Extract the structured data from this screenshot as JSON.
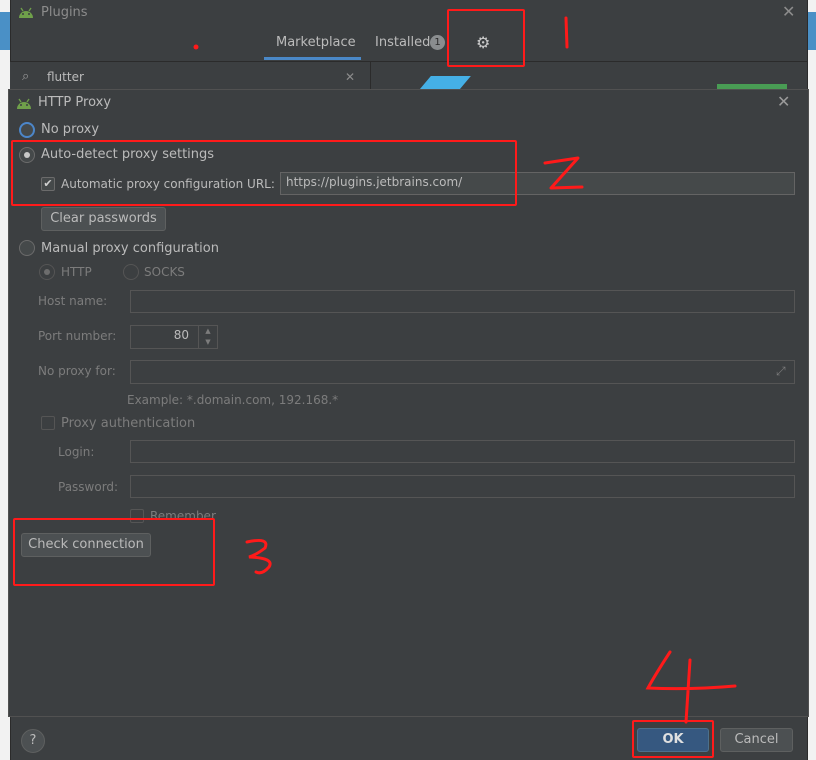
{
  "plugins_window": {
    "title": "Plugins",
    "tabs": [
      {
        "label": "Marketplace"
      },
      {
        "label": "Installed",
        "badge": "1"
      }
    ],
    "search_value": "flutter"
  },
  "proxy_dialog": {
    "title": "HTTP Proxy",
    "no_proxy": {
      "label": "No proxy"
    },
    "auto_detect": {
      "label": "Auto-detect proxy settings",
      "selected": true
    },
    "auto_config_url": {
      "label": "Automatic proxy configuration URL:",
      "checked": true,
      "value": "https://plugins.jetbrains.com/"
    },
    "clear_passwords_label": "Clear passwords",
    "manual": {
      "label": "Manual proxy configuration"
    },
    "http_label": "HTTP",
    "socks_label": "SOCKS",
    "host_name_label": "Host name:",
    "port_number_label": "Port number:",
    "port_value": "80",
    "no_proxy_for_label": "No proxy for:",
    "example_text": "Example: *.domain.com, 192.168.*",
    "proxy_auth_label": "Proxy authentication",
    "login_label": "Login:",
    "password_label": "Password:",
    "remember_label": "Remember",
    "check_connection_label": "Check connection",
    "help_label": "?",
    "ok_label": "OK",
    "cancel_label": "Cancel"
  },
  "annotation_color": "#ff1a1a",
  "accent_color": "#4a88c7"
}
